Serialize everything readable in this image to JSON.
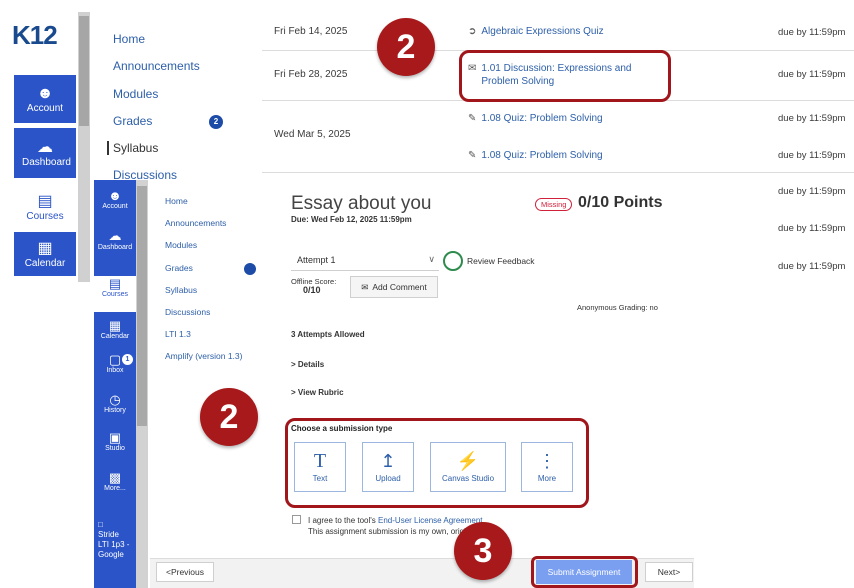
{
  "back_nav": {
    "logo": "K12",
    "items": [
      {
        "label": "Account",
        "icon": "user-circle-icon"
      },
      {
        "label": "Dashboard",
        "icon": "dashboard-gauge-icon"
      },
      {
        "label": "Courses",
        "icon": "book-icon"
      },
      {
        "label": "Calendar",
        "icon": "calendar-icon"
      }
    ]
  },
  "back_course_nav": {
    "items": [
      "Home",
      "Announcements",
      "Modules",
      "Grades",
      "Syllabus",
      "Discussions"
    ],
    "grades_badge": "2"
  },
  "schedule": {
    "rows": [
      {
        "date": "Fri Feb 14, 2025",
        "title": "Algebraic Expressions Quiz",
        "icon": "rocket-quiz-icon",
        "due": "due by 11:59pm"
      },
      {
        "date": "Fri Feb 28, 2025",
        "title": "1.01 Discussion: Expressions and Problem Solving",
        "icon": "discussion-icon",
        "due": "due by 11:59pm"
      },
      {
        "date": "Wed Mar 5, 2025",
        "title": "1.08 Quiz: Problem Solving",
        "icon": "quiz-icon",
        "due": "due by 11:59pm"
      },
      {
        "date": "",
        "title": "1.08 Quiz: Problem Solving",
        "icon": "quiz-icon",
        "due": "due by 11:59pm"
      }
    ],
    "extra_due": [
      "due by 11:59pm",
      "due by 11:59pm",
      "due by 11:59pm"
    ]
  },
  "front_nav": {
    "items": [
      {
        "label": "Account",
        "icon": "user-circle-icon"
      },
      {
        "label": "Dashboard",
        "icon": "dashboard-gauge-icon"
      },
      {
        "label": "Courses",
        "icon": "book-icon"
      },
      {
        "label": "Calendar",
        "icon": "calendar-icon"
      },
      {
        "label": "Inbox",
        "icon": "inbox-icon",
        "badge": "1"
      },
      {
        "label": "History",
        "icon": "clock-icon"
      },
      {
        "label": "Studio",
        "icon": "studio-icon"
      },
      {
        "label": "More...",
        "icon": "more-grid-icon"
      },
      {
        "label": "Stride LTI 1p3 - Google",
        "icon": "image-icon"
      }
    ]
  },
  "front_course_nav": {
    "items": [
      "Home",
      "Announcements",
      "Modules",
      "Grades",
      "Syllabus",
      "Discussions",
      "LTI 1.3",
      "Amplify (version 1.3)"
    ]
  },
  "assignment": {
    "title": "Essay about you",
    "due": "Due: Wed Feb 12, 2025 11:59pm",
    "status": "Missing",
    "points": "0/10 Points",
    "attempt": "Attempt 1",
    "review_feedback": "Review Feedback",
    "offline_score_label": "Offline Score:",
    "offline_score": "0/10",
    "add_comment": "Add Comment",
    "anon_grading": "Anonymous Grading: no",
    "attempts_allowed": "3 Attempts Allowed",
    "details": "Details",
    "view_rubric": "View Rubric",
    "submission_label": "Choose a submission type",
    "submission_types": [
      {
        "label": "Text",
        "icon": "text-t-icon"
      },
      {
        "label": "Upload",
        "icon": "upload-icon"
      },
      {
        "label": "Canvas Studio",
        "icon": "plug-icon"
      },
      {
        "label": "More",
        "icon": "more-vertical-icon"
      }
    ],
    "eula_text_1": "I agree to the tool's ",
    "eula_link": "End-User License Agreement",
    "eula_text_2": "This assignment submission is my own, original work"
  },
  "footer": {
    "previous": "Previous",
    "submit": "Submit Assignment",
    "next": "Next"
  },
  "callouts": [
    "2",
    "2",
    "3"
  ],
  "colors": {
    "nav_blue": "#2a54c8",
    "link_blue": "#2d5fa8",
    "callout_red": "#a8191b",
    "missing_red": "#d0213a",
    "submit_blue": "#7b9ff0"
  }
}
